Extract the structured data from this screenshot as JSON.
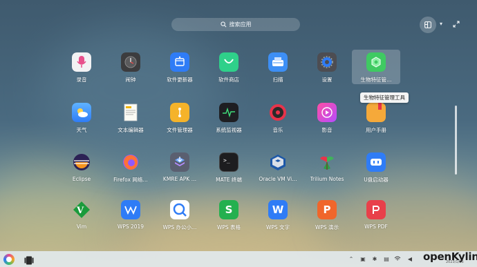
{
  "search": {
    "placeholder": "搜索应用"
  },
  "tooltip": "生物特征管理工具",
  "apps": [
    {
      "label": "录音",
      "icon": "microphone-icon"
    },
    {
      "label": "闹钟",
      "icon": "alarm-clock-icon"
    },
    {
      "label": "软件更新器",
      "icon": "software-updater-icon"
    },
    {
      "label": "软件商店",
      "icon": "software-store-icon"
    },
    {
      "label": "扫描",
      "icon": "scanner-icon"
    },
    {
      "label": "设置",
      "icon": "settings-icon"
    },
    {
      "label": "生物特征管…",
      "icon": "biometric-icon"
    },
    {
      "label": "天气",
      "icon": "weather-icon"
    },
    {
      "label": "文本编辑器",
      "icon": "text-editor-icon"
    },
    {
      "label": "文件管理器",
      "icon": "file-manager-icon"
    },
    {
      "label": "系统监视器",
      "icon": "system-monitor-icon"
    },
    {
      "label": "音乐",
      "icon": "music-icon"
    },
    {
      "label": "影音",
      "icon": "video-player-icon"
    },
    {
      "label": "用户手册",
      "icon": "user-manual-icon"
    },
    {
      "label": "Eclipse",
      "icon": "eclipse-icon"
    },
    {
      "label": "Firefox 网络…",
      "icon": "firefox-icon"
    },
    {
      "label": "KMRE APK …",
      "icon": "kmre-apk-icon"
    },
    {
      "label": "MATE 终端",
      "icon": "terminal-icon"
    },
    {
      "label": "Oracle VM Vi…",
      "icon": "virtualbox-icon"
    },
    {
      "label": "Trilium Notes",
      "icon": "trilium-icon"
    },
    {
      "label": "U盘启动器",
      "icon": "usb-boot-icon"
    },
    {
      "label": "Vim",
      "icon": "vim-icon"
    },
    {
      "label": "WPS 2019",
      "icon": "wps-2019-icon"
    },
    {
      "label": "WPS 办公小…",
      "icon": "wps-assistant-icon"
    },
    {
      "label": "WPS 表格",
      "icon": "wps-spreadsheet-icon"
    },
    {
      "label": "WPS 文字",
      "icon": "wps-writer-icon"
    },
    {
      "label": "WPS 演示",
      "icon": "wps-presentation-icon"
    },
    {
      "label": "WPS PDF",
      "icon": "wps-pdf-icon"
    }
  ],
  "brand": {
    "text": "openKylin",
    "date": "2023/1/16"
  },
  "colors": {
    "accent": "#2f7cf6",
    "label": "#ffffff"
  }
}
